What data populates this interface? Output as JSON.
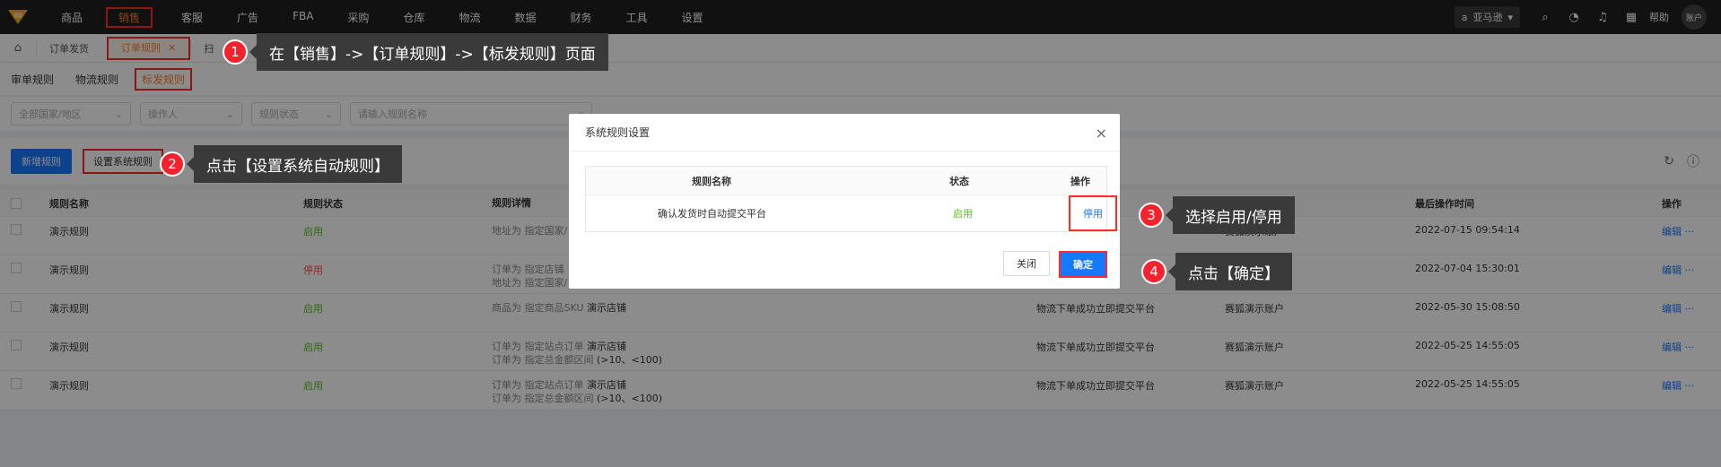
{
  "nav": {
    "items": [
      "商品",
      "销售",
      "客服",
      "广告",
      "FBA",
      "采购",
      "仓库",
      "物流",
      "数据",
      "财务",
      "工具",
      "设置"
    ],
    "store": "亚马逊",
    "help": "帮助",
    "account": "账户"
  },
  "tabs": {
    "t1": "订单发货",
    "t2": "订单规则",
    "t3": "扫"
  },
  "subtabs": [
    "审单规则",
    "物流规则",
    "标发规则"
  ],
  "filters": {
    "country": "全部国家/地区",
    "operator": "操作人",
    "status": "规则状态",
    "search_placeholder": "请输入规则名称"
  },
  "toolbar": {
    "add": "新增规则",
    "system": "设置系统规则"
  },
  "table": {
    "headers": {
      "name": "规则名称",
      "status": "规则状态",
      "detail": "规则详情",
      "time": "最后操作时间",
      "op": "操作"
    },
    "rows": [
      {
        "name": "演示规则",
        "status": "启用",
        "d1": "地址为 指定国家/",
        "d1b": "",
        "d2": "",
        "d2b": "",
        "logistics": "",
        "operator": "赛狐演示账户",
        "time": "2022-07-15 09:54:14",
        "op": "编辑 ···"
      },
      {
        "name": "演示规则",
        "status": "停用",
        "d1": "订单为 指定店铺",
        "d1b": "",
        "d2": "地址为 指定国家/",
        "d2b": "",
        "logistics": "",
        "operator": "",
        "time": "2022-07-04 15:30:01",
        "op": "编辑 ···"
      },
      {
        "name": "演示规则",
        "status": "启用",
        "d1": "商品为 指定商品SKU ",
        "d1b": "演示店铺",
        "d2": "",
        "d2b": "",
        "logistics": "物流下单成功立即提交平台",
        "operator": "赛狐演示账户",
        "time": "2022-05-30 15:08:50",
        "op": "编辑 ···"
      },
      {
        "name": "演示规则",
        "status": "启用",
        "d1": "订单为 指定站点订单 ",
        "d1b": "演示店铺",
        "d2": "订单为 指定总金额区间 ",
        "d2b": "(>10、<100)",
        "logistics": "物流下单成功立即提交平台",
        "operator": "赛狐演示账户",
        "time": "2022-05-25 14:55:05",
        "op": "编辑 ···"
      },
      {
        "name": "演示规则",
        "status": "启用",
        "d1": "订单为 指定站点订单 ",
        "d1b": "演示店铺",
        "d2": "订单为 指定总金额区间 ",
        "d2b": "(>10、<100)",
        "logistics": "物流下单成功立即提交平台",
        "operator": "赛狐演示账户",
        "time": "2022-05-25 14:55:05",
        "op": "编辑 ···"
      }
    ]
  },
  "modal": {
    "title": "系统规则设置",
    "col_name": "规则名称",
    "col_status": "状态",
    "col_op": "操作",
    "row_name": "确认发货时自动提交平台",
    "row_status": "启用",
    "row_op": "停用",
    "cancel": "关闭",
    "ok": "确定"
  },
  "callouts": {
    "c1": {
      "n": "1",
      "text": "在【销售】->【订单规则】->【标发规则】页面"
    },
    "c2": {
      "n": "2",
      "text": "点击【设置系统自动规则】"
    },
    "c3": {
      "n": "3",
      "text": "选择启用/停用"
    },
    "c4": {
      "n": "4",
      "text": "点击【确定】"
    }
  },
  "colors": {
    "accent": "#ff7a2a",
    "primary": "#1677ff",
    "highlight": "#ff2a2a",
    "enabled": "#52c41a",
    "disabled": "#ff4d4f"
  }
}
